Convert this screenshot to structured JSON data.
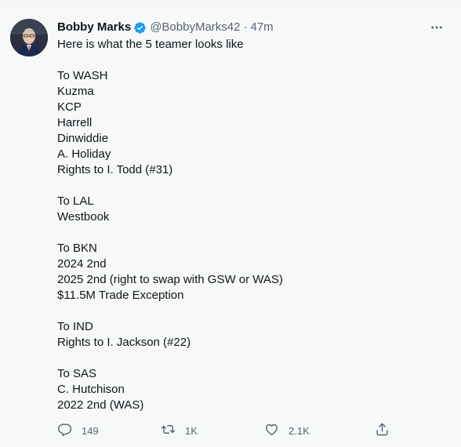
{
  "tweet": {
    "display_name": "Bobby Marks",
    "handle": "@BobbyMarks42",
    "separator": "·",
    "time": "47m",
    "lines": [
      "Here is what the 5 teamer looks like",
      "",
      "To WASH",
      "Kuzma",
      "KCP",
      "Harrell",
      "Dinwiddie",
      "A. Holiday",
      "Rights to I. Todd (#31)",
      "",
      "To LAL",
      "Westbook",
      "",
      "To BKN",
      "2024 2nd",
      "2025 2nd (right to swap with GSW or WAS)",
      "$11.5M Trade Exception",
      "",
      "To IND",
      "Rights to I. Jackson (#22)",
      "",
      "To SAS",
      "C. Hutchison",
      "2022 2nd (WAS)"
    ],
    "actions": {
      "reply_count": "149",
      "retweet_count": "1K",
      "like_count": "2.1K"
    }
  },
  "icons": {
    "verified": "verified-badge-icon",
    "more": "more-options-icon",
    "reply": "reply-icon",
    "retweet": "retweet-icon",
    "like": "like-icon",
    "share": "share-icon"
  },
  "colors": {
    "background": "#f7f9f9",
    "text": "#0f1419",
    "secondary": "#536471",
    "verified": "#1d9bf0"
  }
}
